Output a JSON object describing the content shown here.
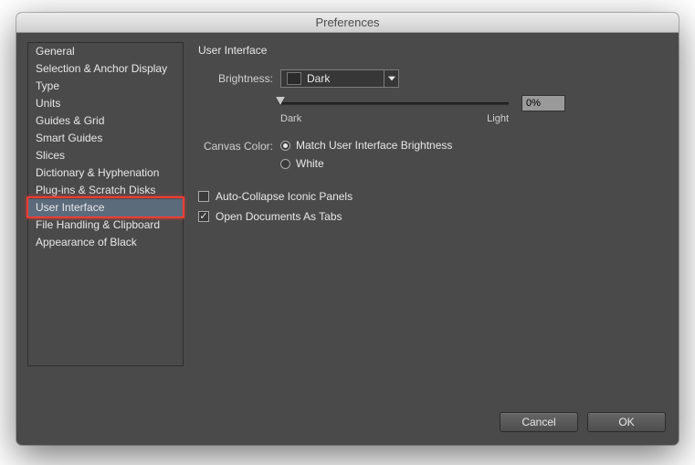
{
  "window": {
    "title": "Preferences"
  },
  "sidebar": {
    "items": [
      "General",
      "Selection & Anchor Display",
      "Type",
      "Units",
      "Guides & Grid",
      "Smart Guides",
      "Slices",
      "Dictionary & Hyphenation",
      "Plug-ins & Scratch Disks",
      "User Interface",
      "File Handling & Clipboard",
      "Appearance of Black"
    ],
    "selected_index": 9,
    "highlighted_index": 9
  },
  "panel": {
    "title": "User Interface",
    "brightness": {
      "label": "Brightness:",
      "value": "Dark",
      "slider": {
        "min_label": "Dark",
        "max_label": "Light",
        "percent": "0%"
      }
    },
    "canvas_color": {
      "label": "Canvas Color:",
      "options": [
        "Match User Interface Brightness",
        "White"
      ],
      "selected_index": 0
    },
    "checks": {
      "auto_collapse": {
        "label": "Auto-Collapse Iconic Panels",
        "checked": false
      },
      "open_as_tabs": {
        "label": "Open Documents As Tabs",
        "checked": true
      }
    }
  },
  "footer": {
    "cancel": "Cancel",
    "ok": "OK"
  }
}
